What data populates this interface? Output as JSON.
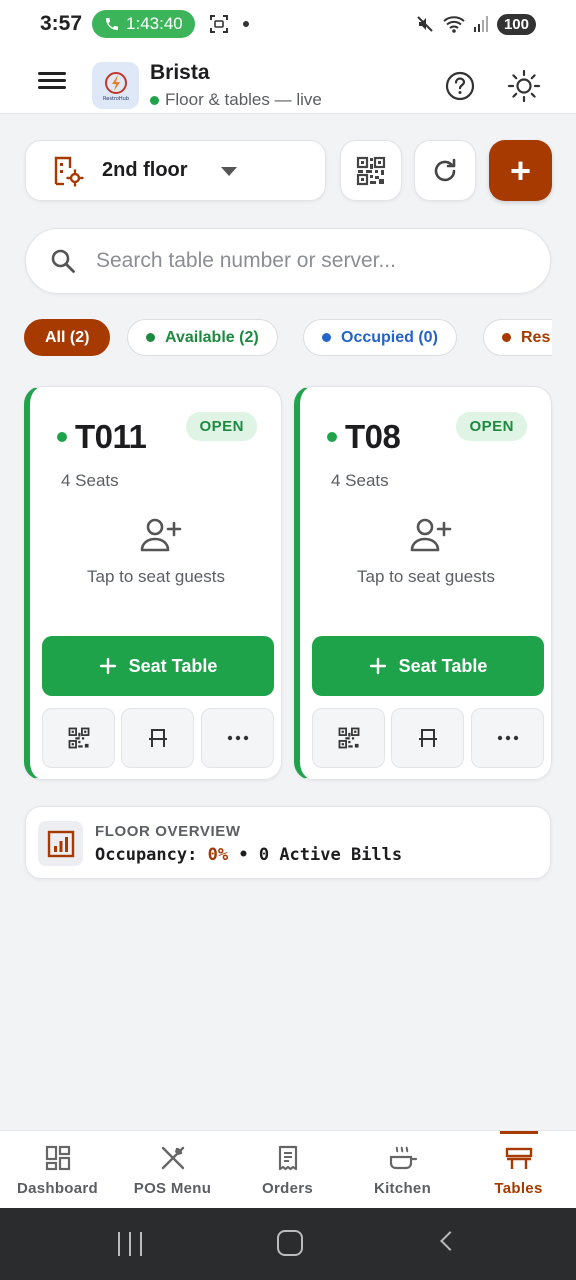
{
  "status_bar": {
    "time": "3:57",
    "call_duration": "1:43:40",
    "battery": "100"
  },
  "app": {
    "title": "Brista",
    "subtitle": "Floor & tables — live",
    "logo_text": "RestroHub"
  },
  "controls": {
    "floor_selected": "2nd floor",
    "add_label": "+"
  },
  "search": {
    "placeholder": "Search table number or server..."
  },
  "filters": [
    {
      "label": "All (2)",
      "color": "#ffffff"
    },
    {
      "label": "Available (2)",
      "color": "#1e8a40"
    },
    {
      "label": "Occupied (0)",
      "color": "#2463c9"
    },
    {
      "label": "Res",
      "color": "#a63a00"
    }
  ],
  "tables": [
    {
      "name": "T011",
      "status": "OPEN",
      "seats": "4 Seats",
      "hint": "Tap to seat guests",
      "action": "Seat Table"
    },
    {
      "name": "T08",
      "status": "OPEN",
      "seats": "4 Seats",
      "hint": "Tap to seat guests",
      "action": "Seat Table"
    }
  ],
  "overview": {
    "title": "FLOOR OVERVIEW",
    "occupancy_label": "Occupancy:",
    "occupancy_value": "0%",
    "separator": "•",
    "bills": "0 Active Bills"
  },
  "bottom_nav": [
    {
      "label": "Dashboard",
      "icon": "dashboard-icon"
    },
    {
      "label": "POS Menu",
      "icon": "utensils-icon"
    },
    {
      "label": "Orders",
      "icon": "receipt-icon"
    },
    {
      "label": "Kitchen",
      "icon": "cooking-pot-icon"
    },
    {
      "label": "Tables",
      "icon": "table-icon"
    }
  ],
  "colors": {
    "brand": "#a63a00",
    "available": "#1fa34a",
    "occupied": "#2463c9"
  }
}
